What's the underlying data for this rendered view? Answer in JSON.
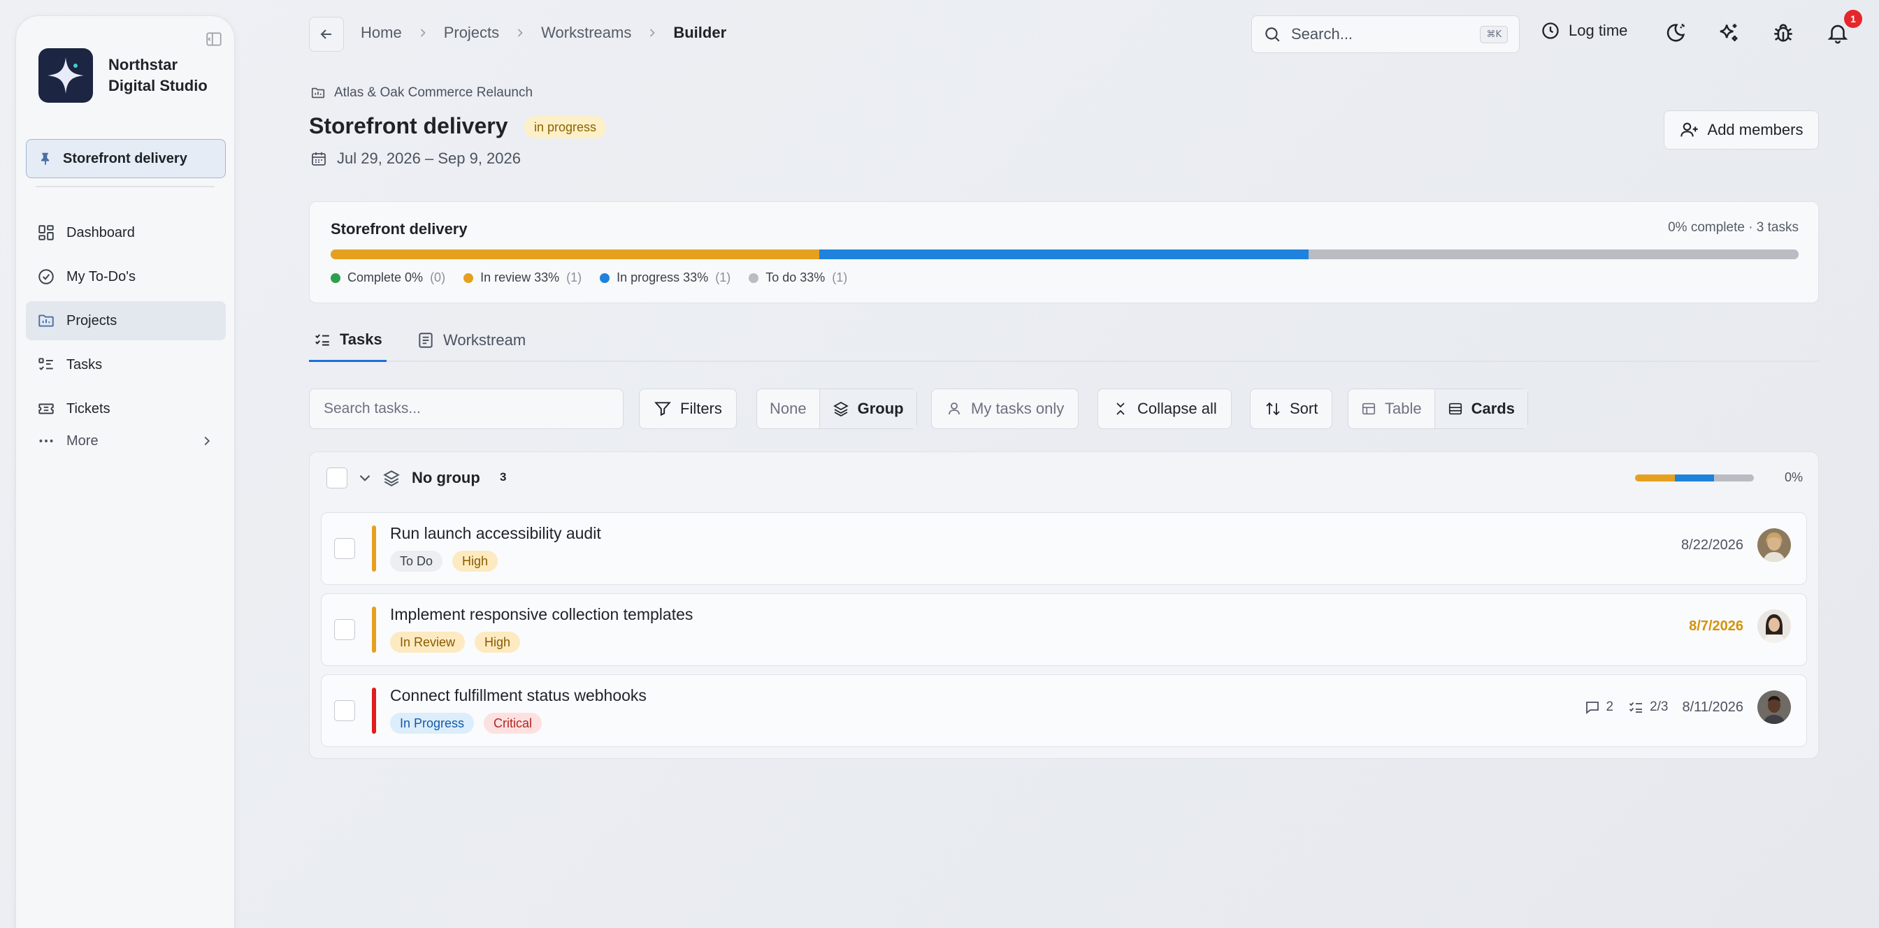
{
  "sidebar": {
    "brand": "Northstar Digital Studio",
    "pinned": "Storefront delivery",
    "items": [
      {
        "label": "Dashboard",
        "icon": "dashboard-icon"
      },
      {
        "label": "My To-Do's",
        "icon": "check-circle-icon"
      },
      {
        "label": "Projects",
        "icon": "folder-icon",
        "active": true
      },
      {
        "label": "Tasks",
        "icon": "task-list-icon"
      },
      {
        "label": "Tickets",
        "icon": "ticket-icon"
      }
    ],
    "more": "More"
  },
  "breadcrumb": [
    "Home",
    "Projects",
    "Workstreams",
    "Builder"
  ],
  "search": {
    "placeholder": "Search...",
    "shortcut": "⌘K"
  },
  "topbar": {
    "log_time": "Log time",
    "notifications_count": "1"
  },
  "header": {
    "project": "Atlas & Oak Commerce Relaunch",
    "title": "Storefront delivery",
    "status": "in progress",
    "dates": "Jul 29, 2026 – Sep 9, 2026",
    "add_members": "Add members"
  },
  "progress": {
    "title": "Storefront delivery",
    "summary": "0% complete · 3 tasks",
    "segments": [
      {
        "label": "Complete 0%",
        "count": "(0)",
        "color": "#2e9e4f",
        "fraction": 0
      },
      {
        "label": "In review 33%",
        "count": "(1)",
        "color": "#e6a020",
        "fraction": 0.333
      },
      {
        "label": "In progress 33%",
        "count": "(1)",
        "color": "#1f82dc",
        "fraction": 0.333
      },
      {
        "label": "To do 33%",
        "count": "(1)",
        "color": "#b9bcc2",
        "fraction": 0.334
      }
    ]
  },
  "tabs": [
    {
      "label": "Tasks",
      "active": true
    },
    {
      "label": "Workstream",
      "active": false
    }
  ],
  "toolbar": {
    "search_placeholder": "Search tasks...",
    "filters": "Filters",
    "none": "None",
    "group": "Group",
    "my_tasks": "My tasks only",
    "collapse": "Collapse all",
    "sort": "Sort",
    "table": "Table",
    "cards": "Cards"
  },
  "group": {
    "title": "No group",
    "count": "3",
    "percent": "0%"
  },
  "tasks": [
    {
      "title": "Run launch accessibility audit",
      "stripe": "#e6a020",
      "status": "To Do",
      "priority": "High",
      "date": "8/22/2026",
      "overdue": false
    },
    {
      "title": "Implement responsive collection templates",
      "stripe": "#e6a020",
      "status": "In Review",
      "priority": "High",
      "date": "8/7/2026",
      "overdue": true
    },
    {
      "title": "Connect fulfillment status webhooks",
      "stripe": "#e11d1d",
      "status": "In Progress",
      "priority": "Critical",
      "date": "8/11/2026",
      "overdue": false,
      "comments": "2",
      "subtasks": "2/3"
    }
  ]
}
